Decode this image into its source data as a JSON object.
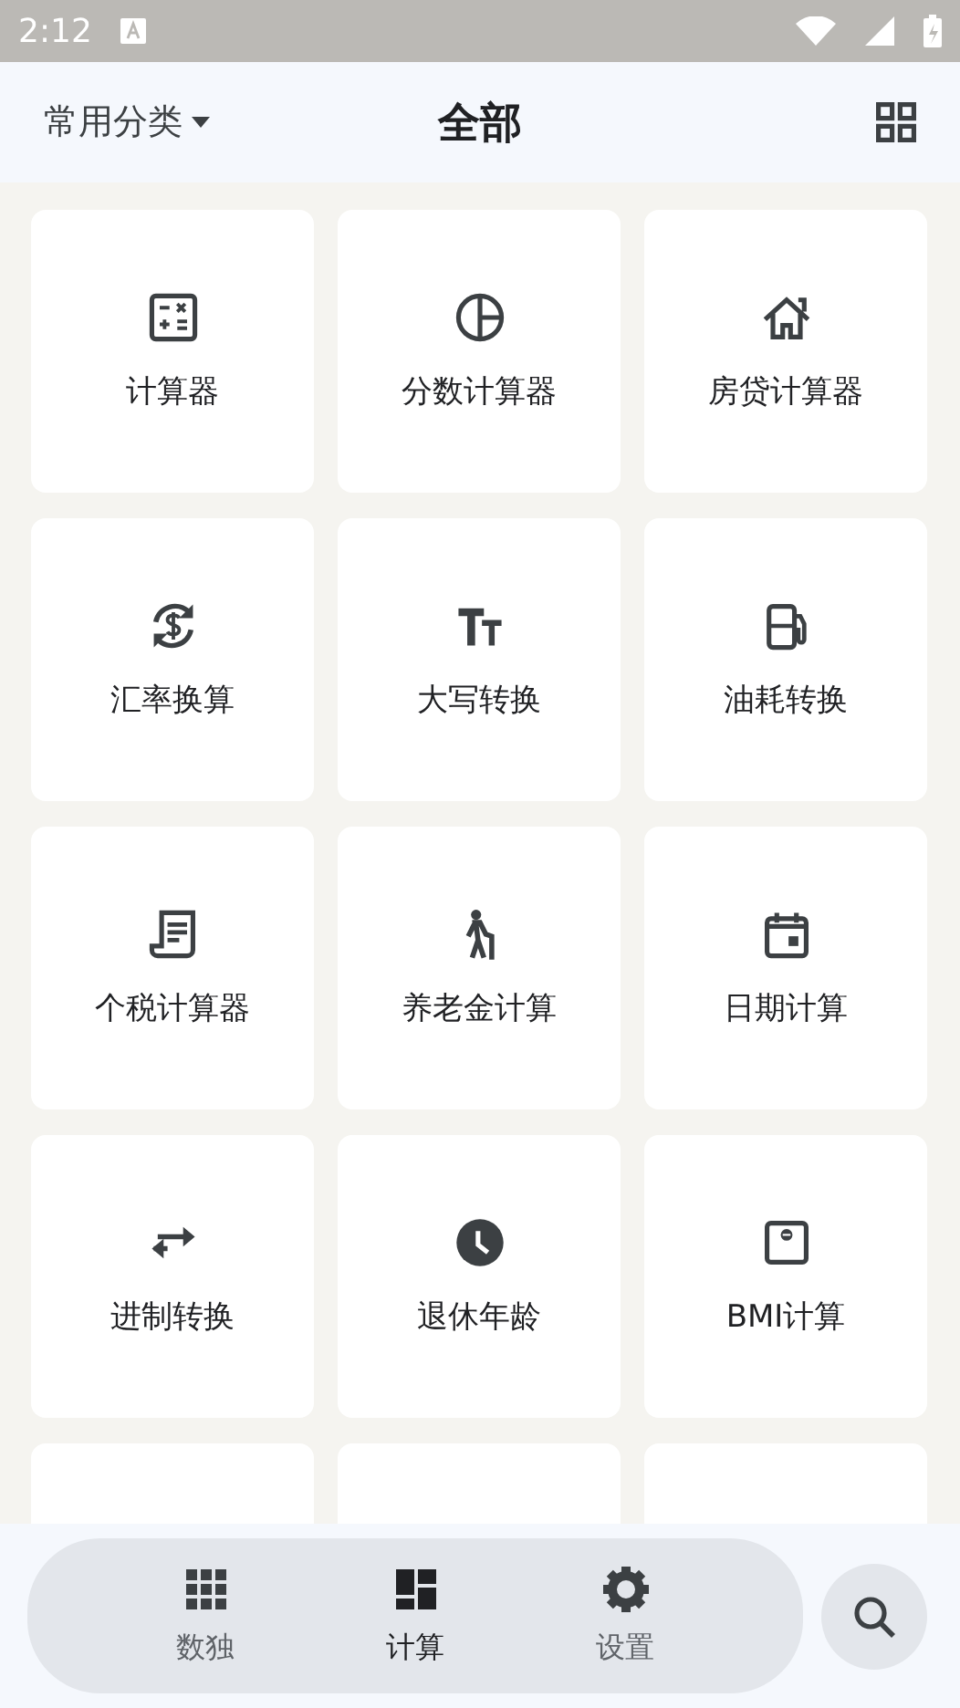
{
  "status_bar": {
    "time": "2:12"
  },
  "header": {
    "category": "常用分类",
    "title": "全部"
  },
  "tiles": [
    {
      "kind": "tool",
      "label": "计算器"
    },
    {
      "kind": "tool",
      "label": "分数计算器"
    },
    {
      "kind": "tool",
      "label": "房贷计算器"
    },
    {
      "kind": "tool",
      "label": "汇率换算"
    },
    {
      "kind": "tool",
      "label": "大写转换"
    },
    {
      "kind": "tool",
      "label": "油耗转换"
    },
    {
      "kind": "tool",
      "label": "个税计算器"
    },
    {
      "kind": "tool",
      "label": "养老金计算"
    },
    {
      "kind": "tool",
      "label": "日期计算"
    },
    {
      "kind": "tool",
      "label": "进制转换"
    },
    {
      "kind": "tool",
      "label": "退休年龄"
    },
    {
      "kind": "tool",
      "label": "BMI计算"
    },
    {
      "kind": "blank"
    },
    {
      "kind": "blank"
    },
    {
      "kind": "blank"
    }
  ],
  "bottom_nav": [
    {
      "label": "数独",
      "selected": false
    },
    {
      "label": "计算",
      "selected": true
    },
    {
      "label": "设置",
      "selected": false
    }
  ]
}
